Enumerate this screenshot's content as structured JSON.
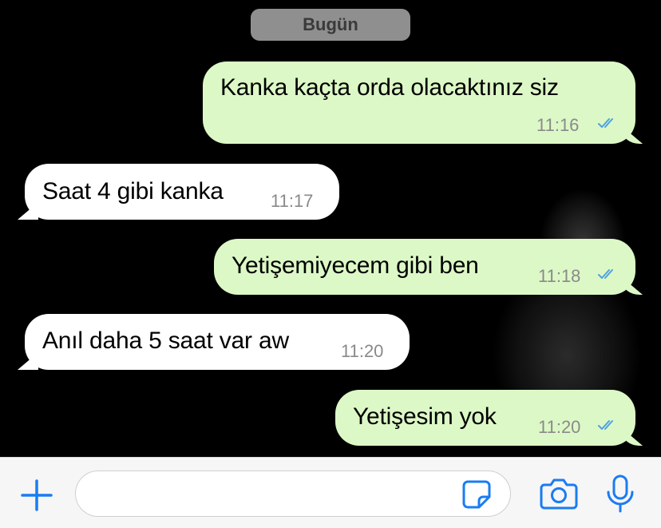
{
  "date_separator": "Bugün",
  "messages": [
    {
      "direction": "out",
      "text": "Kanka kaçta orda olacaktınız siz",
      "time": "11:16",
      "status": "read"
    },
    {
      "direction": "in",
      "text": "Saat 4 gibi kanka",
      "time": "11:17"
    },
    {
      "direction": "out",
      "text": "Yetişemiyecem gibi ben",
      "time": "11:18",
      "status": "read"
    },
    {
      "direction": "in",
      "text": "Anıl daha 5 saat var aw",
      "time": "11:20"
    },
    {
      "direction": "out",
      "text": "Yetişesim yok",
      "time": "11:20",
      "status": "read"
    }
  ],
  "input_bar": {
    "placeholder": "",
    "icons": [
      "plus-icon",
      "sticker-icon",
      "camera-icon",
      "microphone-icon"
    ]
  },
  "colors": {
    "background": "#000000",
    "outgoing_bubble": "#dcf8c6",
    "incoming_bubble": "#ffffff",
    "date_pill": "#8f8f8f",
    "read_ticks": "#4fa3e0",
    "accent": "#1a7cf2"
  }
}
